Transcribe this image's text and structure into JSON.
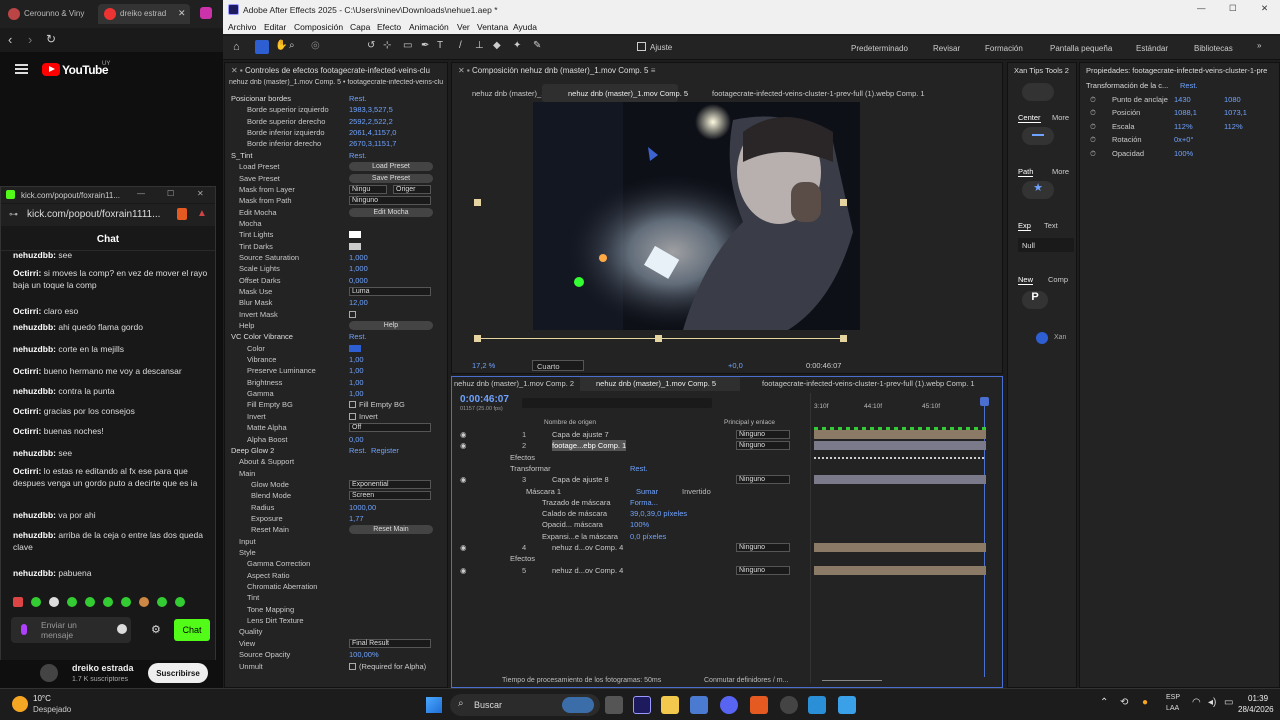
{
  "browser": {
    "tabs": [
      {
        "label": "Cerounno & Viny"
      },
      {
        "label": "dreiko estrad"
      }
    ],
    "youtube_label": "YouTube",
    "youtube_region": "UY",
    "kick": {
      "window_title": "kick.com/popout/foxrain11...",
      "url": "kick.com/popout/foxrain1111...",
      "chat_title": "Chat",
      "messages": [
        {
          "user": "nehuzdbb:",
          "text": "see"
        },
        {
          "user": "Octirri:",
          "text": "si moves la comp? en vez de mover el rayo baja un toque la comp"
        },
        {
          "user": "Octirri:",
          "text": "claro eso"
        },
        {
          "user": "nehuzdbb:",
          "text": "ahi quedo flama gordo"
        },
        {
          "user": "nehuzdbb:",
          "text": "corte en la mejills"
        },
        {
          "user": "Octirri:",
          "text": "bueno hermano me voy a descansar"
        },
        {
          "user": "nehuzdbb:",
          "text": "contra la punta"
        },
        {
          "user": "Octirri:",
          "text": "gracias por los consejos"
        },
        {
          "user": "Octirri:",
          "text": "buenas noches!"
        },
        {
          "user": "nehuzdbb:",
          "text": "see"
        },
        {
          "user": "Octirri:",
          "text": "lo estas re editando al fx ese para que despues venga un gordo puto a decirte que es ia"
        },
        {
          "user": "nehuzdbb:",
          "text": "va por ahi"
        },
        {
          "user": "nehuzdbb:",
          "text": "arriba de la ceja o entre las dos queda clave"
        },
        {
          "user": "nehuzdbb:",
          "text": "pabuena"
        }
      ],
      "input_placeholder": "Enviar un mensaje",
      "send_label": "Chat"
    },
    "channel": {
      "name": "dreiko estrada",
      "subs": "1.7 K suscriptores",
      "subscribe": "Suscribirse"
    }
  },
  "ae": {
    "title": "Adobe After Effects 2025 - C:\\Users\\ninev\\Downloads\\nehue1.aep *",
    "menu": [
      "Archivo",
      "Editar",
      "Composición",
      "Capa",
      "Efecto",
      "Animación",
      "Ver",
      "Ventana",
      "Ayuda"
    ],
    "align_label": "Ajuste",
    "workspaces": [
      "Predeterminado",
      "Revisar",
      "Formación",
      "Pantalla pequeña",
      "Estándar",
      "Bibliotecas"
    ],
    "fx_panel": {
      "tab": "Controles de efectos footagecrate-infected-veins-clu",
      "subtitle": "nehuz dnb (master)_1.mov Comp. 5 • footagecrate-infected-veins-clu",
      "rows": [
        {
          "name": "Posicionar bordes",
          "value": "Rest."
        },
        {
          "name": "Borde superior izquierdo",
          "value": "1983,3,527,5"
        },
        {
          "name": "Borde superior derecho",
          "value": "2592,2,522,2"
        },
        {
          "name": "Borde inferior izquierdo",
          "value": "2061,4,1157,0"
        },
        {
          "name": "Borde inferior derecho",
          "value": "2670,3,1151,7"
        },
        {
          "name": "S_Tint",
          "value": "Rest."
        },
        {
          "name": "Load Preset",
          "value": "Load Preset"
        },
        {
          "name": "Save Preset",
          "value": "Save Preset"
        },
        {
          "name": "Mask from Layer",
          "value": "Ningu",
          "value2": "Origer"
        },
        {
          "name": "Mask from Path",
          "value": "Ninguno"
        },
        {
          "name": "Edit Mocha",
          "value": "Edit Mocha"
        },
        {
          "name": "Mocha",
          "value": ""
        },
        {
          "name": "Tint Lights",
          "value": ""
        },
        {
          "name": "Tint Darks",
          "value": ""
        },
        {
          "name": "Source Saturation",
          "value": "1,000"
        },
        {
          "name": "Scale Lights",
          "value": "1,000"
        },
        {
          "name": "Offset Darks",
          "value": "0,000"
        },
        {
          "name": "Mask Use",
          "value": "Luma"
        },
        {
          "name": "Blur Mask",
          "value": "12,00"
        },
        {
          "name": "Invert Mask",
          "value": ""
        },
        {
          "name": "Help",
          "value": "Help"
        },
        {
          "name": "VC Color Vibrance",
          "value": "Rest."
        },
        {
          "name": "Color",
          "value": ""
        },
        {
          "name": "Vibrance",
          "value": "1,00"
        },
        {
          "name": "Preserve Luminance",
          "value": "1,00"
        },
        {
          "name": "Brightness",
          "value": "1,00"
        },
        {
          "name": "Gamma",
          "value": "1,00"
        },
        {
          "name": "Fill Empty BG",
          "value": "Fill Empty BG"
        },
        {
          "name": "Invert",
          "value": "Invert"
        },
        {
          "name": "Matte Alpha",
          "value": "Off"
        },
        {
          "name": "Alpha Boost",
          "value": "0,00"
        },
        {
          "name": "Deep Glow 2",
          "value": "Rest.",
          "value2": "Register"
        },
        {
          "name": "About & Support",
          "value": ""
        },
        {
          "name": "Main",
          "value": ""
        },
        {
          "name": "Glow Mode",
          "value": "Exponential"
        },
        {
          "name": "Blend Mode",
          "value": "Screen"
        },
        {
          "name": "Radius",
          "value": "1000,00"
        },
        {
          "name": "Exposure",
          "value": "1,77"
        },
        {
          "name": "Reset Main",
          "value": "Reset Main"
        },
        {
          "name": "Input",
          "value": ""
        },
        {
          "name": "Style",
          "value": ""
        },
        {
          "name": "Gamma Correction",
          "value": ""
        },
        {
          "name": "Aspect Ratio",
          "value": ""
        },
        {
          "name": "Chromatic Aberration",
          "value": ""
        },
        {
          "name": "Tint",
          "value": ""
        },
        {
          "name": "Tone Mapping",
          "value": ""
        },
        {
          "name": "Lens Dirt Texture",
          "value": ""
        },
        {
          "name": "Quality",
          "value": ""
        },
        {
          "name": "View",
          "value": "Final Result"
        },
        {
          "name": "Source Opacity",
          "value": "100,00%"
        },
        {
          "name": "Unmult",
          "value": "(Required for Alpha)"
        }
      ]
    },
    "comp_panel": {
      "tab": "Composición nehuz dnb (master)_1.mov Comp. 5",
      "subtabs": [
        "nehuz dnb (master)_1",
        "nehuz dnb (master)_1.mov Comp. 5",
        "footagecrate-infected-veins-cluster-1-prev-full (1).webp Comp. 1"
      ],
      "zoom": "17,2 %",
      "quality": "Cuarto",
      "exposure": "+0,0",
      "timecode": "0:00:46:07"
    },
    "timeline": {
      "tabs": [
        "nehuz dnb (master)_1.mov Comp. 2",
        "nehuz dnb (master)_1.mov Comp. 5",
        "footagecrate-infected-veins-cluster-1-prev-full (1).webp Comp. 1"
      ],
      "timecode": "0:00:46:07",
      "frames": "01157 (25.00 fps)",
      "col_source": "Nombre de origen",
      "col_parent": "Principal y enlace",
      "ruler": [
        "3:10f",
        "44:10f",
        "45:10f"
      ],
      "layers": [
        {
          "num": "1",
          "name": "Capa de ajuste 7",
          "parent": "Ninguno"
        },
        {
          "num": "2",
          "name": "footage...ebp Comp. 1",
          "parent": "Ninguno"
        },
        {
          "num": "",
          "name": "Efectos",
          "parent": ""
        },
        {
          "num": "",
          "name": "Transformar",
          "parent": "Rest."
        },
        {
          "num": "3",
          "name": "Capa de ajuste 8",
          "parent": "Ninguno"
        },
        {
          "num": "",
          "name": "Máscara 1",
          "parent": "Sumar",
          "extra": "Invertido"
        },
        {
          "num": "",
          "name": "Trazado de máscara",
          "parent": "Forma..."
        },
        {
          "num": "",
          "name": "Calado de máscara",
          "parent": "39,0,39,0 píxeles"
        },
        {
          "num": "",
          "name": "Opacid... máscara",
          "parent": "100%"
        },
        {
          "num": "",
          "name": "Expansi...e la máscara",
          "parent": "0,0 píxeles"
        },
        {
          "num": "4",
          "name": "nehuz d...ov Comp. 4",
          "parent": "Ninguno"
        },
        {
          "num": "",
          "name": "Efectos",
          "parent": ""
        },
        {
          "num": "5",
          "name": "nehuz d...ov Comp. 4",
          "parent": "Ninguno"
        }
      ],
      "footer": "Tiempo de procesamiento de los fotogramas: 50ms",
      "footer2": "Conmutar definidores / m..."
    },
    "xan": {
      "tab": "Xan Tips Tools 2",
      "center": "Center",
      "more": "More",
      "path": "Path",
      "more2": "More",
      "exp": "Exp",
      "text": "Text",
      "null": "Null",
      "new": "New",
      "comp": "Comp",
      "brand": "Xan"
    },
    "props": {
      "tab": "Propiedades: footagecrate-infected-veins-cluster-1-pre",
      "section": "Transformación de la c...",
      "reset": "Rest.",
      "rows": [
        {
          "name": "Punto de anclaje",
          "v1": "1430",
          "v2": "1080"
        },
        {
          "name": "Posición",
          "v1": "1088,1",
          "v2": "1073,1"
        },
        {
          "name": "Escala",
          "v1": "112%",
          "v2": "112%"
        },
        {
          "name": "Rotación",
          "v1": "0x+0°",
          "v2": ""
        },
        {
          "name": "Opacidad",
          "v1": "100%",
          "v2": ""
        }
      ]
    }
  },
  "taskbar": {
    "weather_temp": "10°C",
    "weather_desc": "Despejado",
    "search": "Buscar",
    "lang1": "ESP",
    "lang2": "LAA",
    "time": "01:39",
    "date": "28/4/2026"
  }
}
